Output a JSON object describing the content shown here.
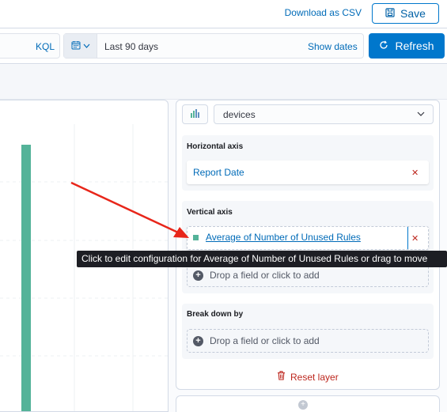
{
  "toolbar": {
    "download_label": "Download as CSV",
    "save_label": "Save"
  },
  "query_bar": {
    "language_label": "KQL",
    "date_range": "Last 90 days",
    "show_dates_label": "Show dates",
    "refresh_label": "Refresh"
  },
  "chart": {
    "bar_color": "#54b399"
  },
  "config": {
    "layer_name": "devices",
    "horizontal_axis": {
      "title": "Horizontal axis",
      "field": "Report Date"
    },
    "vertical_axis": {
      "title": "Vertical axis",
      "field": "Average of Number of Unused Rules",
      "series_color": "#54b399",
      "drop_label": "Drop a field or click to add"
    },
    "breakdown": {
      "title": "Break down by",
      "drop_label": "Drop a field or click to add"
    },
    "reset_label": "Reset layer"
  },
  "tooltip": {
    "text": "Click to edit configuration for Average of Number of Unused Rules or drag to move"
  },
  "colors": {
    "primary": "#0077cc",
    "danger": "#bd271e",
    "annotation_arrow": "#e8261a"
  }
}
